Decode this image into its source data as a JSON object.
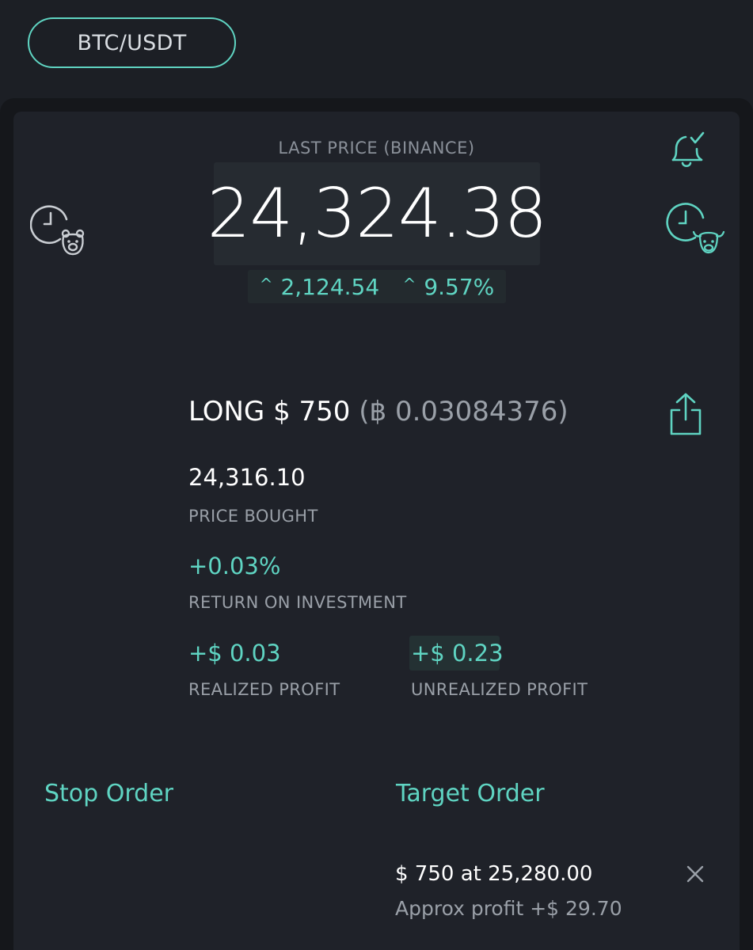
{
  "header": {
    "pair_label": "BTC/USDT"
  },
  "ticker": {
    "label": "LAST PRICE (BINANCE)",
    "price": "24,324.38",
    "change_abs": "2,124.54",
    "change_pct": "9.57%",
    "caret": "^"
  },
  "icons": {
    "bear": "clock-bear-icon",
    "bull": "clock-bull-icon",
    "bell": "bell-check-icon",
    "share": "share-icon",
    "close": "close-icon"
  },
  "position": {
    "side_amount": "LONG $ 750",
    "btc_amount": "(฿ 0.03084376)",
    "price_bought": "24,316.10",
    "price_bought_label": "PRICE BOUGHT",
    "roi": "+0.03%",
    "roi_label": "RETURN ON INVESTMENT",
    "realized_profit": "+$ 0.03",
    "realized_profit_label": "REALIZED PROFIT",
    "unrealized_profit": "+$ 0.23",
    "unrealized_profit_label": "UNREALIZED PROFIT"
  },
  "orders": {
    "stop_heading": "Stop Order",
    "target_heading": "Target Order",
    "target_line": "$ 750 at 25,280.00",
    "target_profit": "Approx profit +$ 29.70"
  },
  "colors": {
    "accent": "#5fd4c2",
    "background": "#1c1f25",
    "panel": "#1f2229",
    "muted_text": "#9aa0a8"
  }
}
